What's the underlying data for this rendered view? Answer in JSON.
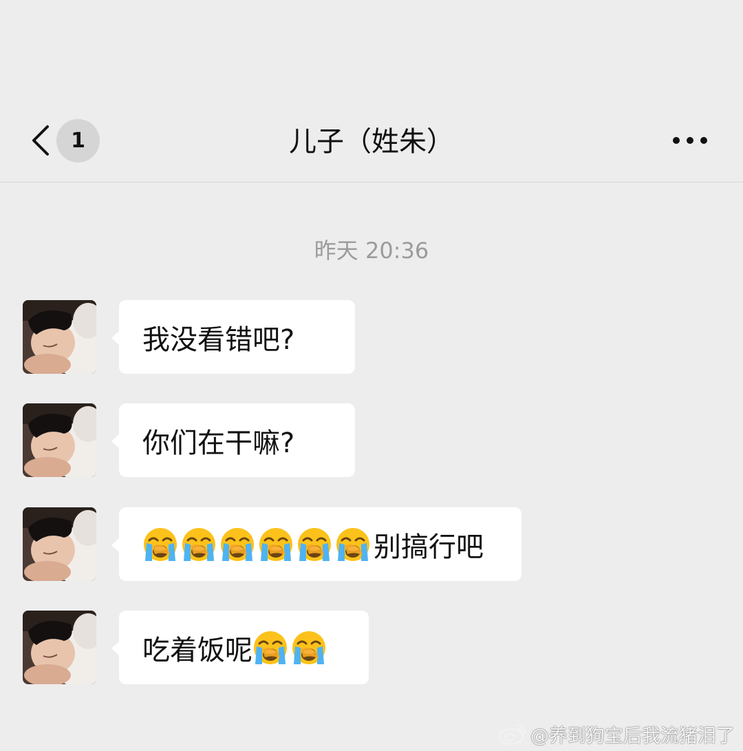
{
  "header": {
    "unread_count": "1",
    "title": "儿子（姓朱）"
  },
  "timestamp": "昨天 20:36",
  "messages": [
    {
      "text": "我没看错吧?"
    },
    {
      "text": "你们在干嘛?"
    },
    {
      "text": "别搞行吧",
      "emoji_before": 6,
      "emoji_name": "loudly-crying-face"
    },
    {
      "text": "吃着饭呢",
      "emoji_after": 2,
      "emoji_name": "loudly-crying-face"
    }
  ],
  "watermark": {
    "text": "@养到狗宝后我流猪泪了",
    "icon": "weibo-logo"
  },
  "colors": {
    "background": "#ededed",
    "bubble": "#ffffff",
    "timestamp": "#9b9b9b",
    "unread_badge": "#d5d5d5"
  }
}
